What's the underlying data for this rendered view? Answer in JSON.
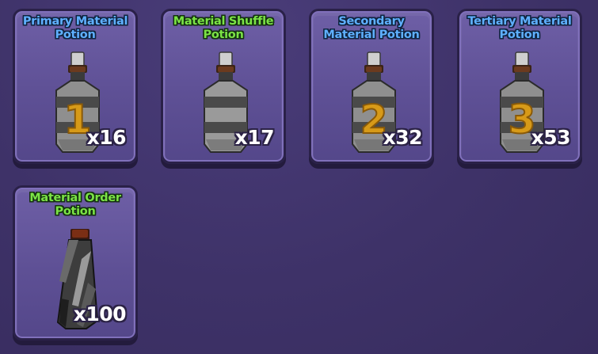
{
  "inventory": {
    "items": [
      {
        "title": "Primary Material Potion",
        "quantity": "x16",
        "label_digit": "1",
        "title_color": "#5fb0ff",
        "icon": "striped-bottle-icon"
      },
      {
        "title": "Material Shuffle Potion",
        "quantity": "x17",
        "label_digit": "",
        "title_color": "#7be346",
        "icon": "striped-bottle-icon"
      },
      {
        "title": "Secondary Material Potion",
        "quantity": "x32",
        "label_digit": "2",
        "title_color": "#5fb0ff",
        "icon": "striped-bottle-icon"
      },
      {
        "title": "Tertiary Material Potion",
        "quantity": "x53",
        "label_digit": "3",
        "title_color": "#5fb0ff",
        "icon": "striped-bottle-icon"
      },
      {
        "title": "Material Order Potion",
        "quantity": "x100",
        "label_digit": "",
        "title_color": "#7be346",
        "icon": "twisted-bottle-icon"
      }
    ]
  },
  "colors": {
    "background": "#3e3268",
    "card_fill": "#5e5095",
    "card_border": "#2a2148",
    "bottle_gray": "#8a8a8a",
    "bottle_stripe": "#4a4a4a",
    "cork": "#6b3a1e",
    "digit_gold": "#d79a18"
  }
}
